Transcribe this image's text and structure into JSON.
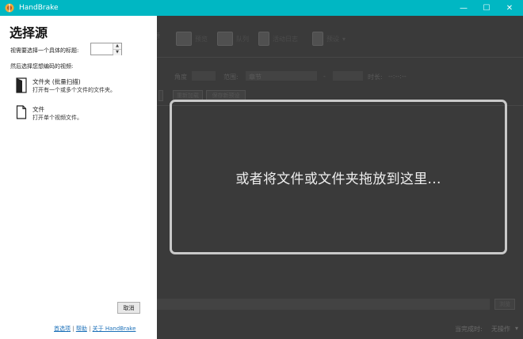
{
  "window": {
    "title": "HandBrake",
    "minimize_glyph": "—",
    "maximize_glyph": "☐",
    "close_glyph": "✕",
    "titlebar_color": "#00b7c3"
  },
  "source_panel": {
    "heading": "选择源",
    "title_prompt": "视需要选择一个具体的标题:",
    "title_value": "",
    "then_select": "然后选择您想编码的视频:",
    "folder_option": {
      "icon": "folder-icon",
      "title": "文件夹 (批量扫描)",
      "desc": "打开有一个或多个文件的文件夹。"
    },
    "file_option": {
      "icon": "file-icon",
      "title": "文件",
      "desc": "打开单个视频文件。"
    },
    "cancel_label": "取消",
    "links": {
      "preferences": "首选项",
      "help": "帮助",
      "about": "关于 HandBrake",
      "separator": "|"
    }
  },
  "main_window": {
    "toolbar": [
      "源",
      "预览",
      "队列",
      "活动日志",
      "预设"
    ],
    "source_row": {
      "angle_label": "角度",
      "range_label": "范围:",
      "range_value": "章节",
      "dash": "-",
      "duration_label": "时长:",
      "duration_value": "--:--:--"
    },
    "preset_buttons": [
      "重新加载",
      "保存新预设"
    ],
    "browse_label": "浏览",
    "when_done_label": "当完成时:",
    "when_done_value": "无操作"
  },
  "dropzone": {
    "text": "或者将文件或文件夹拖放到这里..."
  }
}
